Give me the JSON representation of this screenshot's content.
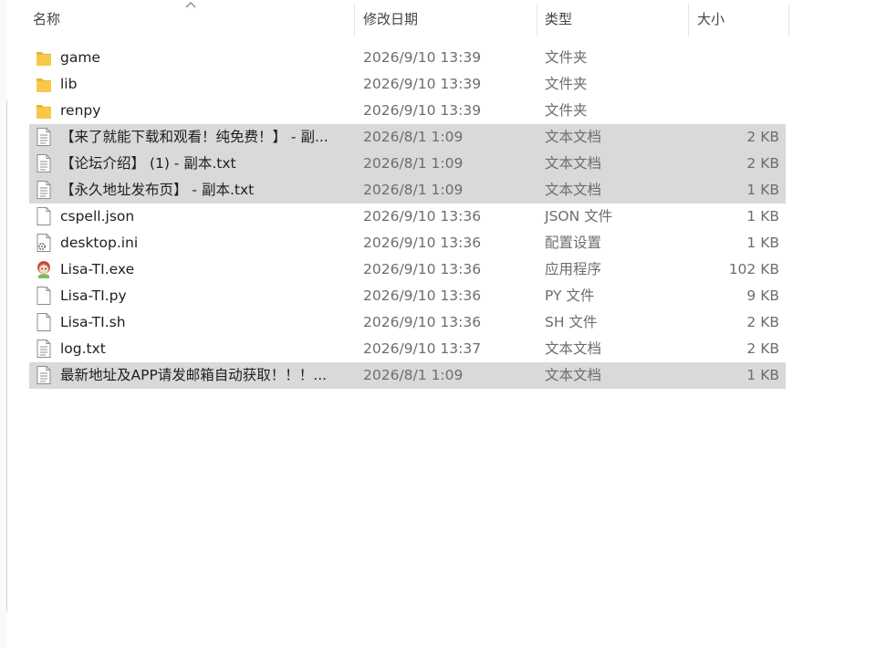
{
  "header": {
    "name": "名称",
    "date": "修改日期",
    "type": "类型",
    "size": "大小"
  },
  "files": [
    {
      "name": "game",
      "date": "2026/9/10 13:39",
      "type": "文件夹",
      "size": "",
      "icon": "folder-icon",
      "selected": false
    },
    {
      "name": "lib",
      "date": "2026/9/10 13:39",
      "type": "文件夹",
      "size": "",
      "icon": "folder-icon",
      "selected": false
    },
    {
      "name": "renpy",
      "date": "2026/9/10 13:39",
      "type": "文件夹",
      "size": "",
      "icon": "folder-icon",
      "selected": false
    },
    {
      "name": "【来了就能下载和观看！纯免费！】 - 副...",
      "date": "2026/8/1 1:09",
      "type": "文本文档",
      "size": "2 KB",
      "icon": "text-document-icon",
      "selected": true
    },
    {
      "name": "【论坛介绍】 (1) - 副本.txt",
      "date": "2026/8/1 1:09",
      "type": "文本文档",
      "size": "2 KB",
      "icon": "text-document-icon",
      "selected": true
    },
    {
      "name": "【永久地址发布页】 - 副本.txt",
      "date": "2026/8/1 1:09",
      "type": "文本文档",
      "size": "1 KB",
      "icon": "text-document-icon",
      "selected": true
    },
    {
      "name": "cspell.json",
      "date": "2026/9/10 13:36",
      "type": "JSON 文件",
      "size": "1 KB",
      "icon": "blank-file-icon",
      "selected": false
    },
    {
      "name": "desktop.ini",
      "date": "2026/9/10 13:36",
      "type": "配置设置",
      "size": "1 KB",
      "icon": "settings-file-icon",
      "selected": false
    },
    {
      "name": "Lisa-TI.exe",
      "date": "2026/9/10 13:36",
      "type": "应用程序",
      "size": "102 KB",
      "icon": "app-icon",
      "selected": false
    },
    {
      "name": "Lisa-TI.py",
      "date": "2026/9/10 13:36",
      "type": "PY 文件",
      "size": "9 KB",
      "icon": "blank-file-icon",
      "selected": false
    },
    {
      "name": "Lisa-TI.sh",
      "date": "2026/9/10 13:36",
      "type": "SH 文件",
      "size": "2 KB",
      "icon": "blank-file-icon",
      "selected": false
    },
    {
      "name": "log.txt",
      "date": "2026/9/10 13:37",
      "type": "文本文档",
      "size": "2 KB",
      "icon": "text-document-icon",
      "selected": false
    },
    {
      "name": "最新地址及APP请发邮箱自动获取！！！...",
      "date": "2026/8/1 1:09",
      "type": "文本文档",
      "size": "1 KB",
      "icon": "text-document-icon",
      "selected": true
    }
  ],
  "colors": {
    "selected_row": "#d9d9d9",
    "folder": "#f8c948"
  }
}
